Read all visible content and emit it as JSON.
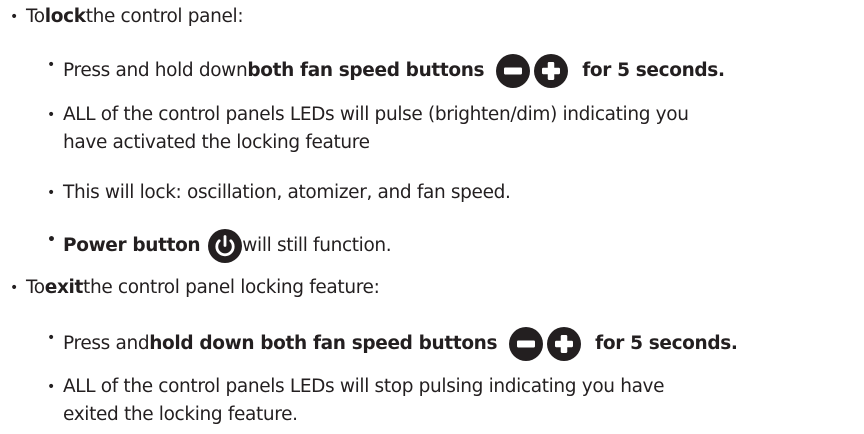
{
  "section_lock": {
    "intro_a": "To ",
    "intro_b": "lock",
    "intro_c": " the control panel:",
    "item1_a": "Press and hold down ",
    "item1_b": "both fan speed buttons",
    "item1_c": "for 5 seconds.",
    "item2_line1": "ALL of the control panels LEDs will pulse (brighten/dim) indicating you",
    "item2_line2": "have activated the locking feature",
    "item3": "This will lock: oscillation, atomizer, and fan speed.",
    "item4_a": "Power button",
    "item4_c": " will still function."
  },
  "section_exit": {
    "intro_a": "To ",
    "intro_b": "exit",
    "intro_c": " the control panel locking feature:",
    "item1_a": "Press and ",
    "item1_b": "hold down both fan speed buttons",
    "item1_c": "for 5 seconds.",
    "item2_line1": "ALL of the control panels LEDs will stop pulsing indicating you have",
    "item2_line2": "exited the locking feature."
  },
  "bullet_char": "•",
  "icons": {
    "minus": "minus-circle-icon",
    "plus": "plus-circle-icon",
    "power": "power-icon",
    "icon_color": "#231f20"
  }
}
